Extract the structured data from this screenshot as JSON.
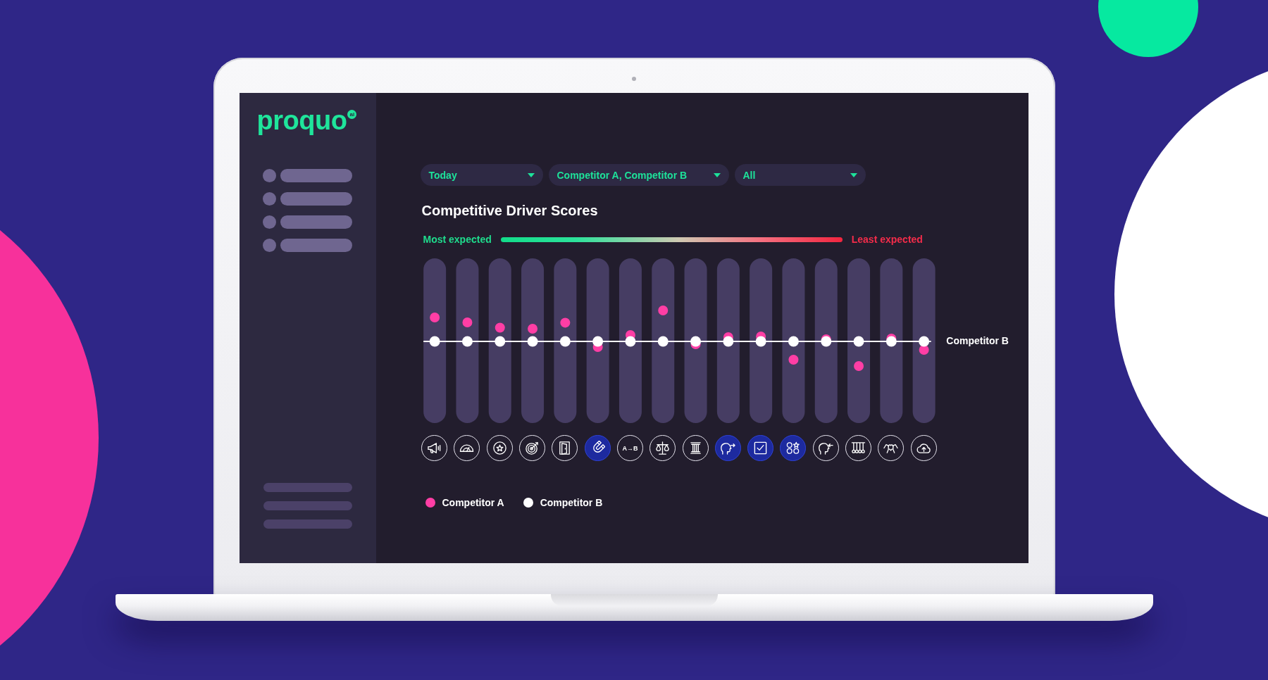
{
  "logo": {
    "wordmark": "proquo",
    "badge": "ai"
  },
  "sidebar": {
    "nav_placeholders": [
      {
        "kind": "icon-line"
      },
      {
        "kind": "icon-line"
      },
      {
        "kind": "icon-line"
      },
      {
        "kind": "icon-line"
      }
    ],
    "footer_placeholders": [
      {
        "kind": "line"
      },
      {
        "kind": "line"
      },
      {
        "kind": "line"
      }
    ]
  },
  "filters": [
    {
      "value": "Today"
    },
    {
      "value": "Competitor A, Competitor B"
    },
    {
      "value": "All"
    }
  ],
  "chart": {
    "title": "Competitive Driver Scores",
    "scale": {
      "start_label": "Most expected",
      "end_label": "Least expected"
    },
    "reference_label": "Competitor B",
    "drivers": [
      {
        "kind": "megaphone",
        "selected": false
      },
      {
        "kind": "gauge",
        "selected": false
      },
      {
        "kind": "star-badge",
        "selected": false
      },
      {
        "kind": "target",
        "selected": false
      },
      {
        "kind": "door",
        "selected": false
      },
      {
        "kind": "magnet",
        "selected": true
      },
      {
        "kind": "text",
        "label": "A→B",
        "selected": false
      },
      {
        "kind": "scales",
        "selected": false
      },
      {
        "kind": "pillar",
        "selected": false
      },
      {
        "kind": "head-arrow-right",
        "selected": true
      },
      {
        "kind": "checkbox",
        "selected": true
      },
      {
        "kind": "shapes",
        "selected": true
      },
      {
        "kind": "head-arrow-left",
        "selected": false
      },
      {
        "kind": "pendulum",
        "selected": false
      },
      {
        "kind": "hands",
        "selected": false
      },
      {
        "kind": "cloud-upload",
        "selected": false
      }
    ],
    "legend": [
      {
        "label": "Competitor A",
        "color": "#ff3ea5"
      },
      {
        "label": "Competitor B",
        "color": "#ffffff"
      }
    ]
  }
}
